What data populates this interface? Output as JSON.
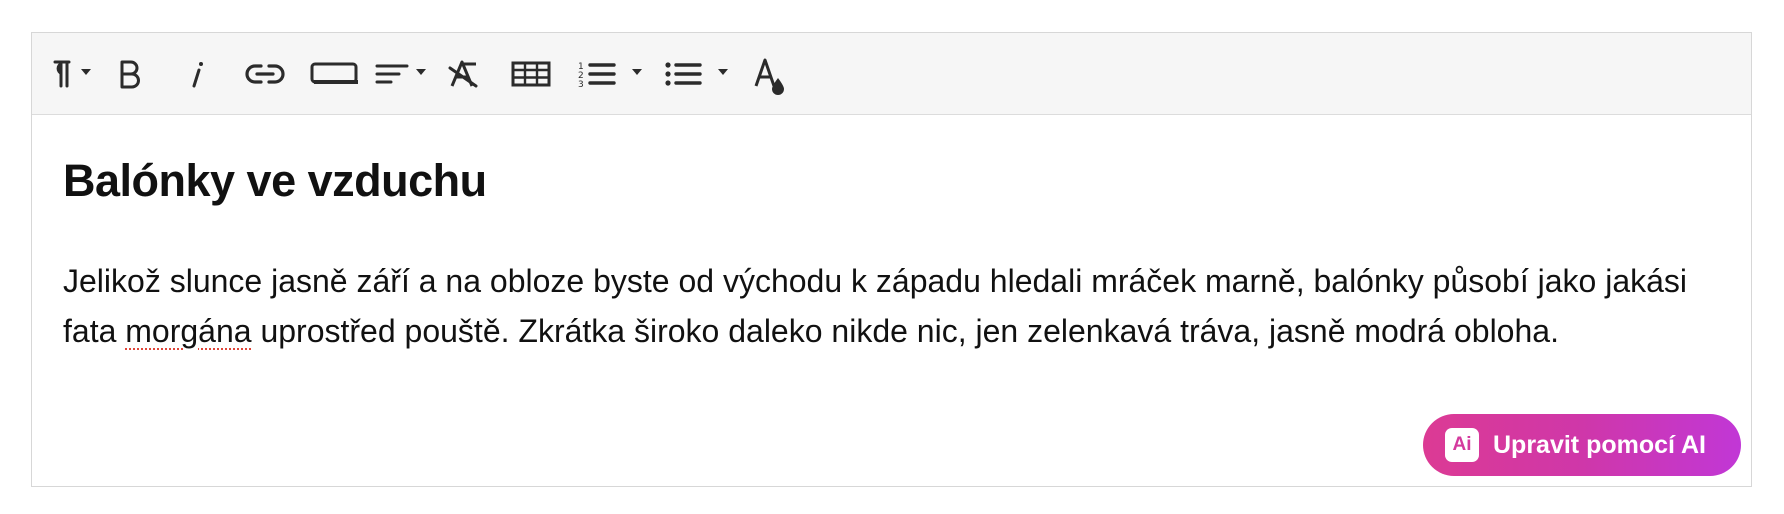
{
  "toolbar": {
    "buttons": [
      {
        "icon": "paragraph-format-icon",
        "has_dropdown": true
      },
      {
        "icon": "bold-icon"
      },
      {
        "icon": "italic-icon"
      },
      {
        "icon": "link-icon"
      },
      {
        "icon": "button-icon"
      },
      {
        "icon": "align-icon",
        "has_dropdown": true
      },
      {
        "icon": "clear-format-icon"
      },
      {
        "icon": "table-icon"
      },
      {
        "icon": "numbered-list-icon",
        "has_dropdown": true
      },
      {
        "icon": "bullet-list-icon",
        "has_dropdown": true
      },
      {
        "icon": "text-color-icon"
      }
    ]
  },
  "document": {
    "heading": "Balónky ve vzduchu",
    "paragraph_before_misspelling": "Jelikož slunce jasně září a na obloze byste od východu k západu hledali mráček marně, balónky působí jako jakási fata ",
    "misspelled_word": "morgána",
    "paragraph_after_misspelling": " uprostřed pouště. Zkrátka široko daleko nikde nic, jen zelenkavá tráva, jasně modrá obloha."
  },
  "ai_button": {
    "badge": "Ai",
    "label": "Upravit pomocí AI"
  },
  "colors": {
    "toolbar_background": "#f6f6f6",
    "border": "#d7d7d7",
    "icon": "#2b2b2b",
    "ai_gradient_start": "#dc3a94",
    "ai_gradient_end": "#c137d6",
    "spellcheck_underline": "#e0463a"
  }
}
